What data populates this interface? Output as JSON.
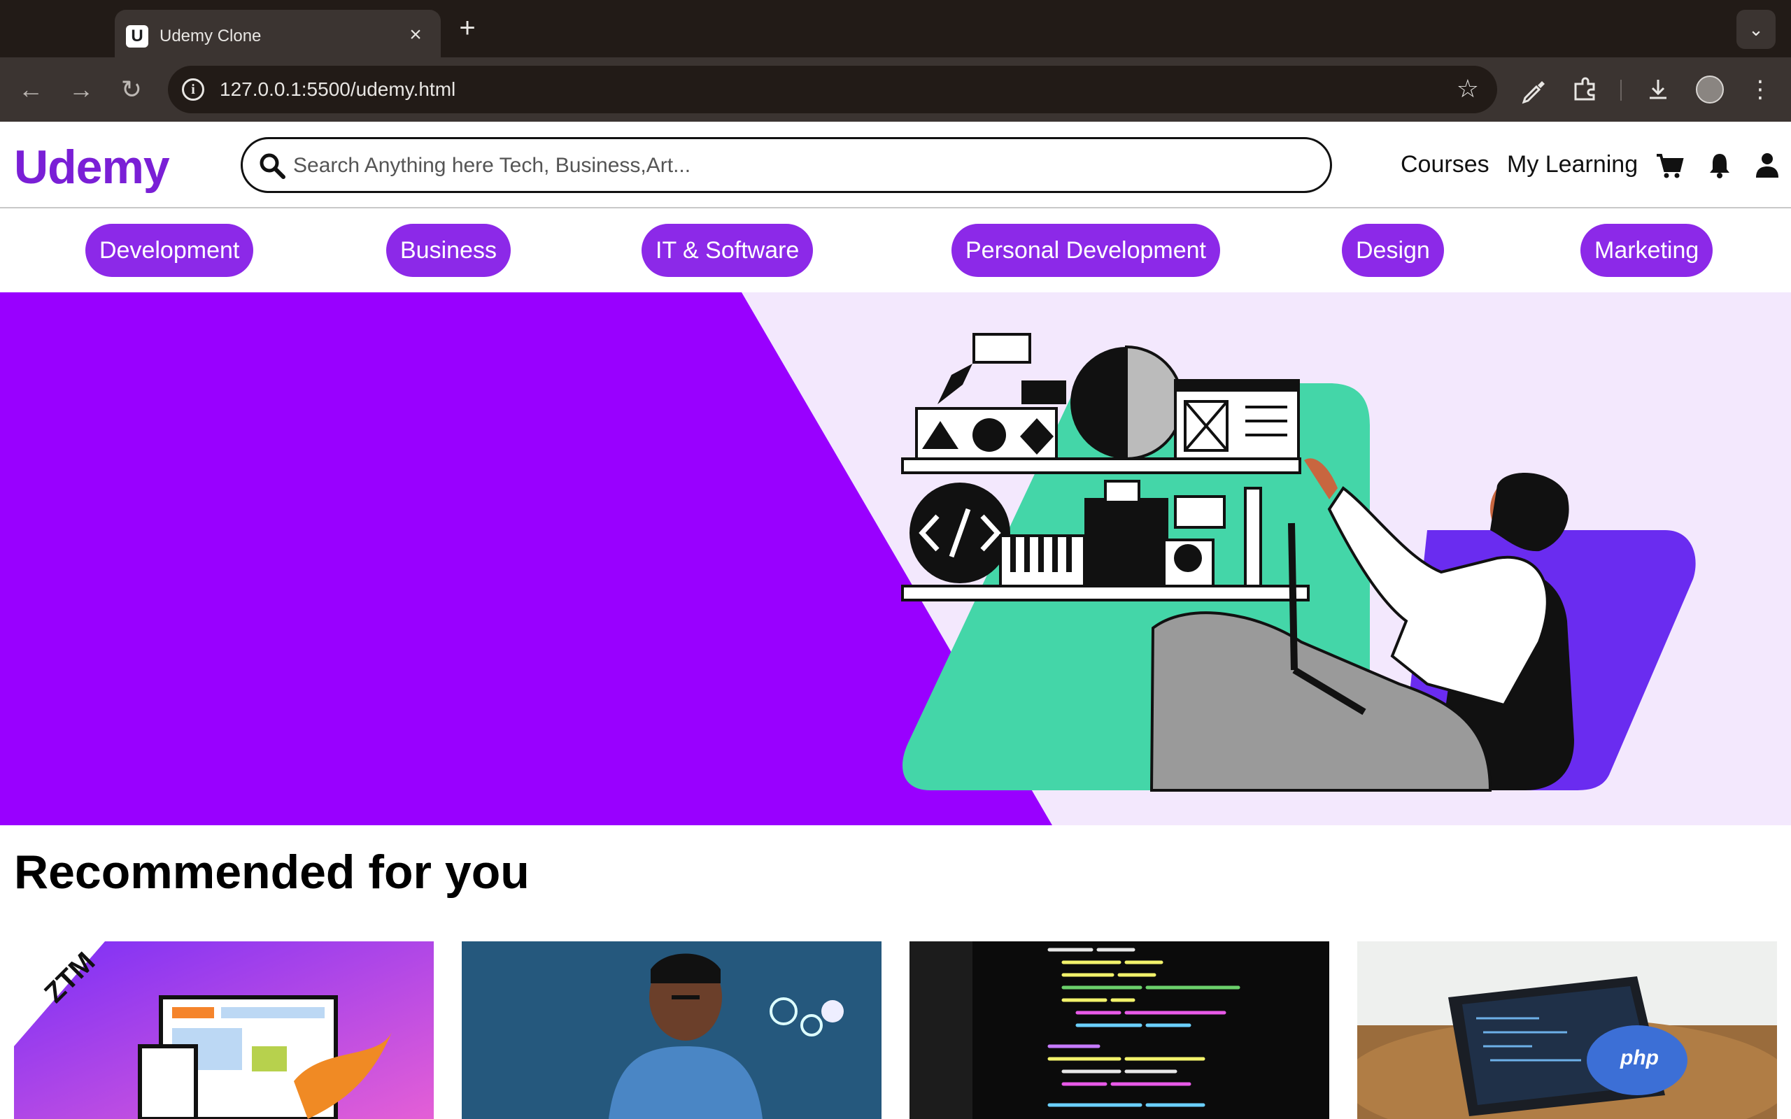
{
  "browser": {
    "tab_title": "Udemy Clone",
    "favicon_letter": "U",
    "url": "127.0.0.1:5500/udemy.html"
  },
  "header": {
    "logo": "Udemy",
    "search_placeholder": "Search Anything here Tech, Business,Art...",
    "nav": {
      "courses": "Courses",
      "my_learning": "My Learning"
    },
    "icons": [
      "cart-icon",
      "bell-icon",
      "user-icon"
    ]
  },
  "categories": [
    "Development",
    "Business",
    "IT & Software",
    "Personal Development",
    "Design",
    "Marketing"
  ],
  "hero": {
    "colors": {
      "purple": "#9900ff",
      "lavender": "#f3e8fd",
      "mint": "#44d6a8",
      "violet": "#6a2cf0"
    }
  },
  "recommended": {
    "title": "Recommended for you",
    "cards": [
      {
        "image": "web-design-course-thumbnail",
        "badge": "ZTM"
      },
      {
        "image": "developer-smiling-thumbnail"
      },
      {
        "image": "code-screen-thumbnail"
      },
      {
        "image": "php-laptop-thumbnail",
        "badge": "php"
      }
    ]
  },
  "colors": {
    "brand": "#7a1fd6",
    "pill": "#8c29e8",
    "chrome_dark": "#221b17",
    "chrome_toolbar": "#3b3431"
  }
}
